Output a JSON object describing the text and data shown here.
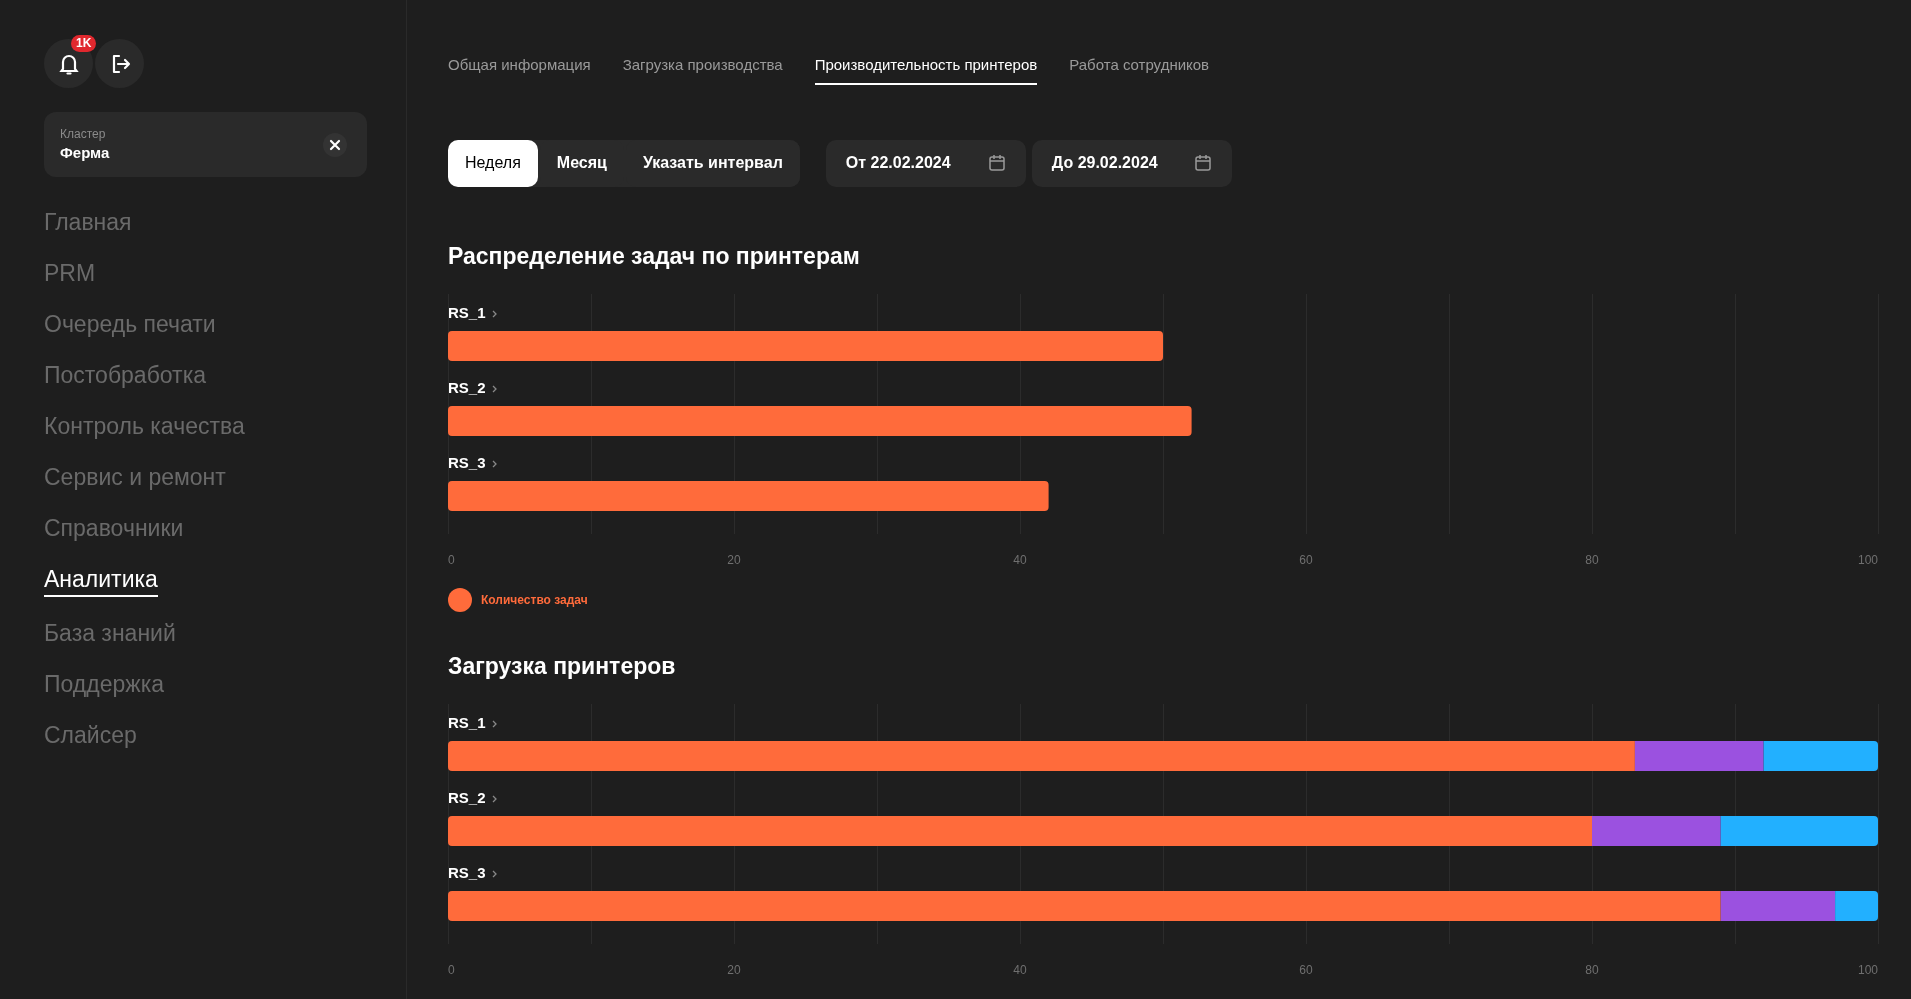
{
  "sidebar": {
    "notifications_badge": "1K",
    "cluster": {
      "label": "Кластер",
      "value": "Ферма"
    },
    "nav": [
      {
        "label": "Главная",
        "selected": false
      },
      {
        "label": "PRM",
        "selected": false
      },
      {
        "label": "Очередь печати",
        "selected": false
      },
      {
        "label": "Постобработка",
        "selected": false
      },
      {
        "label": "Контроль качества",
        "selected": false
      },
      {
        "label": "Сервис и ремонт",
        "selected": false
      },
      {
        "label": "Справочники",
        "selected": false
      },
      {
        "label": "Аналитика",
        "selected": true
      },
      {
        "label": "База знаний",
        "selected": false
      },
      {
        "label": "Поддержка",
        "selected": false
      },
      {
        "label": "Слайсер",
        "selected": false
      }
    ]
  },
  "tabs": [
    {
      "label": "Общая информация",
      "selected": false
    },
    {
      "label": "Загрузка производства",
      "selected": false
    },
    {
      "label": "Производительность принтеров",
      "selected": true
    },
    {
      "label": "Работа сотрудников",
      "selected": false
    }
  ],
  "period": [
    {
      "label": "Неделя",
      "selected": true
    },
    {
      "label": "Месяц",
      "selected": false
    },
    {
      "label": "Указать интервал",
      "selected": false
    }
  ],
  "date_from": "От 22.02.2024",
  "date_to": "До 29.02.2024",
  "sections": [
    {
      "title": "Распределение задач по принтерам",
      "chart_data": {
        "type": "bar",
        "orientation": "horizontal",
        "grid": true,
        "categories": [
          "RS_1",
          "RS_2",
          "RS_3"
        ],
        "series": [
          {
            "name": "Количество задач",
            "color": "#ff6b3b",
            "values": [
              50,
              52,
              42
            ]
          }
        ],
        "xlim": [
          0,
          100
        ],
        "xticks": [
          0,
          20,
          40,
          60,
          80,
          100
        ]
      }
    },
    {
      "title": "Загрузка принтеров",
      "chart_data": {
        "type": "bar",
        "orientation": "horizontal",
        "stacked": true,
        "grid": true,
        "categories": [
          "RS_1",
          "RS_2",
          "RS_3"
        ],
        "series": [
          {
            "color": "#ff6b3b",
            "values": [
              83,
              80,
              89
            ]
          },
          {
            "color": "#9b51e0",
            "values": [
              9,
              9,
              8
            ]
          },
          {
            "color": "#22b0ff",
            "values": [
              8,
              11,
              3
            ]
          }
        ],
        "xlim": [
          0,
          100
        ],
        "xticks": [
          0,
          20,
          40,
          60,
          80,
          100
        ]
      }
    }
  ]
}
